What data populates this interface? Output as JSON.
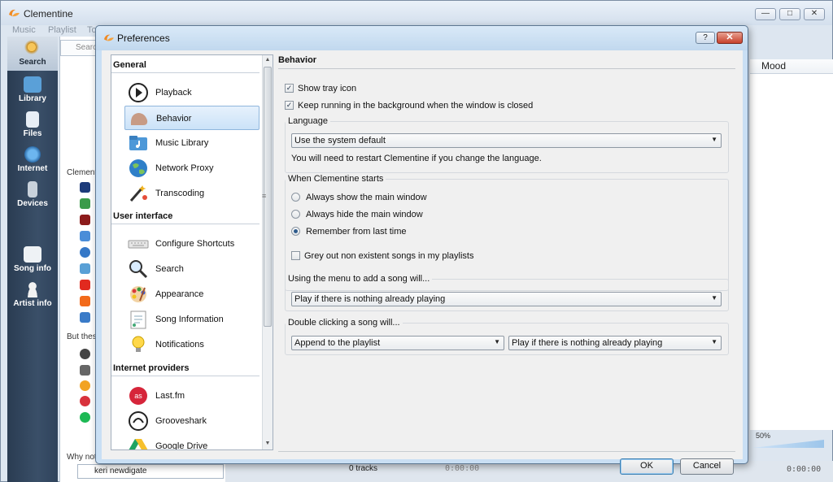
{
  "main_window": {
    "title": "Clementine",
    "menu": [
      "Music",
      "Playlist",
      "To"
    ],
    "sidebar": [
      "Search",
      "Library",
      "Files",
      "Internet",
      "Devices",
      "Song info",
      "Artist info"
    ],
    "search_placeholder": "Searc",
    "panel_texts": {
      "clementine_can": "Clementine",
      "but_these": "But thes",
      "why_not": "Why not"
    },
    "keyword_input": "keri newdigate",
    "tracks_label": "0 tracks",
    "time_left": "0:00:00",
    "time_right": "0:00:00",
    "volume_label": "50%",
    "column_header_mood": "Mood"
  },
  "dialog": {
    "title": "Preferences",
    "help_label": "?",
    "close_label": "✕",
    "nav": {
      "groups": [
        "General",
        "User interface",
        "Internet providers"
      ],
      "general_items": [
        "Playback",
        "Behavior",
        "Music Library",
        "Network Proxy",
        "Transcoding"
      ],
      "ui_items": [
        "Configure Shortcuts",
        "Search",
        "Appearance",
        "Song Information",
        "Notifications"
      ],
      "internet_items": [
        "Last.fm",
        "Grooveshark",
        "Google Drive"
      ],
      "selected": "Behavior"
    },
    "pane": {
      "title": "Behavior",
      "show_tray_icon": "Show tray icon",
      "keep_running": "Keep running in the background when the window is closed",
      "language_group": "Language",
      "language_value": "Use the system default",
      "language_note": "You will need to restart Clementine if you change the language.",
      "starts_group": "When Clementine starts",
      "radio_always_show": "Always show the main window",
      "radio_always_hide": "Always hide the main window",
      "radio_remember": "Remember from last time",
      "grey_out": "Grey out non existent songs in my playlists",
      "menu_add_group": "Using the menu to add a song will...",
      "menu_add_value": "Play if there is nothing already playing",
      "double_click_group": "Double clicking a song will...",
      "double_click_value_1": "Append to the playlist",
      "double_click_value_2": "Play if there is nothing already playing"
    },
    "buttons": {
      "ok": "OK",
      "cancel": "Cancel"
    }
  },
  "colors": {
    "accent": "#3c7fb1",
    "sidebar_bg": "#2f435c",
    "dialog_frame": "#c9dff4",
    "close_red": "#c7402b"
  }
}
